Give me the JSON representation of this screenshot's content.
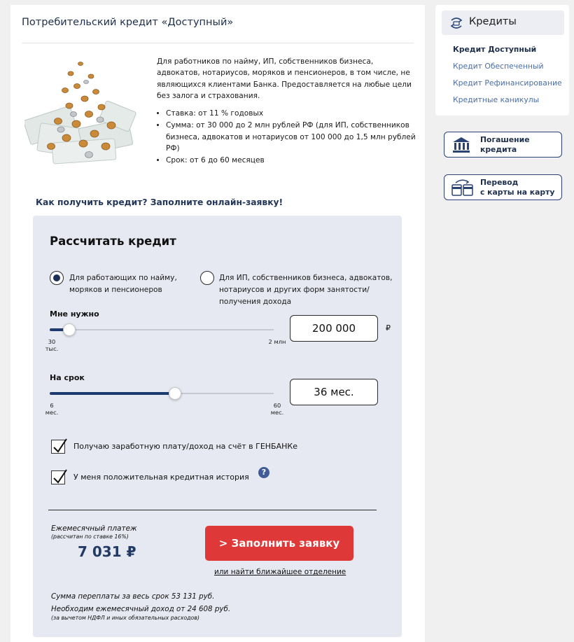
{
  "page_title": "Потребительский кредит «Доступный»",
  "description": {
    "intro": "Для работников по найму, ИП, собственников бизнеса, адвокатов, нотариусов, моряков и пенсионеров, в том числе, не являющихся клиентами Банка. Предоставляется на любые цели без залога и страхования.",
    "bullets": [
      "Ставка: от 11 % годовых",
      "Сумма: от 30 000 до 2 млн рублей РФ (для ИП, собственников бизнеса, адвокатов и нотариусов от 100 000 до 1,5 млн рублей РФ)",
      "Срок: от 6 до 60 месяцев"
    ]
  },
  "cta_heading": "Как получить кредит? Заполните онлайн-заявку!",
  "calculator": {
    "title": "Рассчитать кредит",
    "radio_options": [
      {
        "label": "Для работающих по найму, моряков и пенсионеров",
        "selected": true
      },
      {
        "label": "Для ИП, собственников бизнеса, адвокатов, нотариусов и других форм занятости/ получения дохода",
        "selected": false
      }
    ],
    "amount": {
      "label": "Мне нужно",
      "value": "200 000",
      "currency": "₽",
      "min_label": "30 тыс.",
      "max_label": "2 млн",
      "slider_fraction": 0.088
    },
    "term": {
      "label": "На срок",
      "value": "36 мес.",
      "min_label": "6 мес.",
      "max_label": "60 мес.",
      "slider_fraction": 0.56
    },
    "checkboxes": [
      {
        "label": "Получаю заработную плату/доход на счёт в ГЕНБАНКе",
        "checked": true
      },
      {
        "label": "У меня положительная кредитная история",
        "checked": true
      }
    ],
    "help_glyph": "?",
    "monthly_payment_label": "Ежемесячный платеж",
    "monthly_payment_note": "(рассчитан по ставке 16%)",
    "monthly_payment_value": "7 031 ₽",
    "apply_button": "> Заполнить заявку",
    "branch_link": "или найти ближайшее отделение",
    "overpay_text": "Сумма переплаты за весь срок 53 131 руб.",
    "income_text": "Необходим ежемесячный доход от 24 608 руб.",
    "income_note": "(за вычетом НДФЛ и иных обязательных расходов)"
  },
  "sidebar": {
    "title": "Кредиты",
    "title_icon": "credit-exchange-icon",
    "links": [
      {
        "label": "Кредит Доступный",
        "active": true
      },
      {
        "label": "Кредит Обеспеченный",
        "active": false
      },
      {
        "label": "Кредит Рефинансирование",
        "active": false
      },
      {
        "label": "Кредитные каникулы",
        "active": false
      }
    ],
    "buttons": [
      {
        "line1": "Погашение",
        "line2": "кредита",
        "icon": "bank-building-icon"
      },
      {
        "line1": "Перевод",
        "line2": "с карты на карту",
        "icon": "card-transfer-icon"
      }
    ]
  },
  "colors": {
    "accent_navy": "#1d3a6e",
    "apply_red": "#df3838",
    "calc_bg": "#e6e9f1",
    "link_blue": "#4a6ea6"
  }
}
